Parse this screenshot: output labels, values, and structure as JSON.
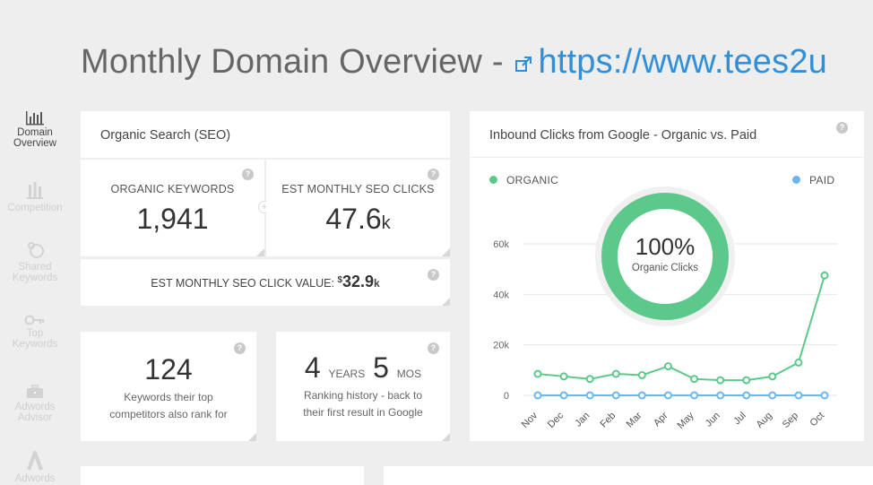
{
  "page": {
    "title_prefix": "Monthly Domain Overview -",
    "title_link": "https://www.tees2u"
  },
  "sidebar": {
    "items": [
      {
        "line1": "Domain",
        "line2": "Overview",
        "icon": "bar-chart-icon",
        "active": true
      },
      {
        "line1": "",
        "line2": "Competition",
        "icon": "trophy-icon",
        "active": false
      },
      {
        "line1": "Shared",
        "line2": "Keywords",
        "icon": "shared-icon",
        "active": false
      },
      {
        "line1": "Top",
        "line2": "Keywords",
        "icon": "key-icon",
        "active": false
      },
      {
        "line1": "Adwords",
        "line2": "Advisor",
        "icon": "briefcase-icon",
        "active": false
      },
      {
        "line1": "",
        "line2": "Adwords",
        "icon": "adwords-icon",
        "active": false
      }
    ]
  },
  "seo_card": {
    "title": "Organic Search (SEO)",
    "organic_keywords": {
      "label": "ORGANIC KEYWORDS",
      "value": "1,941"
    },
    "est_clicks": {
      "label": "EST MONTHLY SEO CLICKS",
      "value": "47.6",
      "suffix": "k"
    },
    "click_value": {
      "label": "EST MONTHLY SEO CLICK VALUE:",
      "currency": "$",
      "value": "32.9",
      "suffix": "k"
    }
  },
  "competitors_tile": {
    "value": "124",
    "line1": "Keywords their top",
    "line2": "competitors also rank for"
  },
  "history_tile": {
    "years": "4",
    "years_label": "YEARS",
    "months": "5",
    "months_label": "MOS",
    "line1": "Ranking history - back to",
    "line2": "their first result in Google"
  },
  "chart_card": {
    "title": "Inbound Clicks from Google - Organic vs. Paid",
    "donut_value": "100%",
    "donut_label": "Organic Clicks"
  },
  "colors": {
    "organic": "#5cc98a",
    "paid": "#6ab6f0",
    "link": "#2f8fd8"
  },
  "chart_data": {
    "type": "line",
    "categories": [
      "Nov",
      "Dec",
      "Jan",
      "Feb",
      "Mar",
      "Apr",
      "May",
      "Jun",
      "Jul",
      "Aug",
      "Sep",
      "Oct"
    ],
    "series": [
      {
        "name": "ORGANIC",
        "values": [
          8500,
          7500,
          6500,
          8500,
          8000,
          11500,
          6500,
          6000,
          6000,
          7500,
          13000,
          47500
        ]
      },
      {
        "name": "PAID",
        "values": [
          0,
          0,
          0,
          0,
          0,
          0,
          0,
          0,
          0,
          0,
          0,
          0
        ]
      }
    ],
    "y_ticks": [
      "0",
      "20k",
      "40k",
      "60k"
    ],
    "ylim": [
      0,
      60000
    ],
    "grid": true,
    "legend": "top"
  }
}
